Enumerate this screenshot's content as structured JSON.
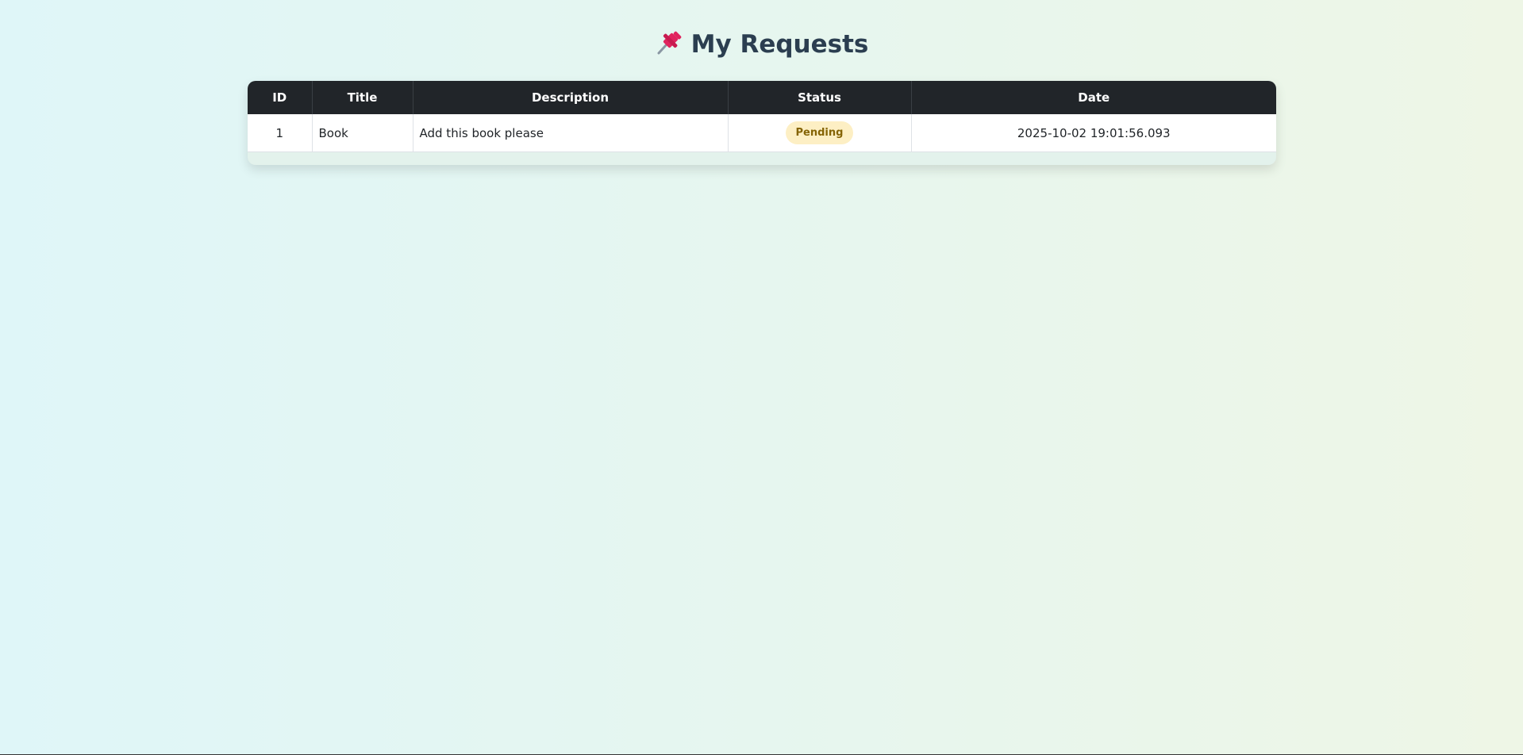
{
  "page": {
    "title": "My Requests",
    "title_icon": "pushpin-icon"
  },
  "table": {
    "headers": {
      "id": "ID",
      "title": "Title",
      "description": "Description",
      "status": "Status",
      "date": "Date"
    },
    "rows": [
      {
        "id": "1",
        "title": "Book",
        "description": "Add this book please",
        "status": "Pending",
        "date": "2025-10-02 19:01:56.093"
      }
    ]
  },
  "colors": {
    "header_bg": "#212529",
    "title_text": "#2b3e50",
    "pending_badge_bg": "#fdefc4",
    "pending_badge_text": "#856404"
  }
}
